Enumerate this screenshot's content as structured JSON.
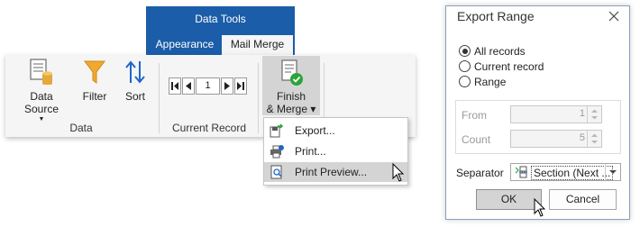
{
  "contextual": {
    "header": "Data Tools"
  },
  "tabs": [
    {
      "label": "Appearance"
    },
    {
      "label": "Mail Merge"
    }
  ],
  "ribbon": {
    "data_group": {
      "label": "Data",
      "buttons": [
        {
          "label": "Data Source",
          "icon": "database-icon"
        },
        {
          "label": "Filter",
          "icon": "funnel-icon"
        },
        {
          "label": "Sort",
          "icon": "sort-arrows-icon"
        }
      ]
    },
    "record_group": {
      "label": "Current Record",
      "record_value": "1"
    },
    "finish_group": {
      "label_line1": "Finish",
      "label_line2": "& Merge ▾"
    }
  },
  "menu": {
    "items": [
      {
        "label": "Export...",
        "icon": "export-icon"
      },
      {
        "label": "Print...",
        "icon": "printer-icon"
      },
      {
        "label": "Print Preview...",
        "icon": "print-preview-icon"
      }
    ]
  },
  "dialog": {
    "title": "Export Range",
    "radios": [
      {
        "label": "All records",
        "checked": true
      },
      {
        "label": "Current record",
        "checked": false
      },
      {
        "label": "Range",
        "checked": false
      }
    ],
    "from_label": "From",
    "from_value": "1",
    "count_label": "Count",
    "count_value": "5",
    "separator_label": "Separator",
    "separator_value": "Section (Next ...",
    "ok_label": "OK",
    "cancel_label": "Cancel"
  },
  "colors": {
    "accent": "#1b5da8",
    "ribbon_bg": "#f5f5f5",
    "highlight": "#d4d4d4"
  }
}
